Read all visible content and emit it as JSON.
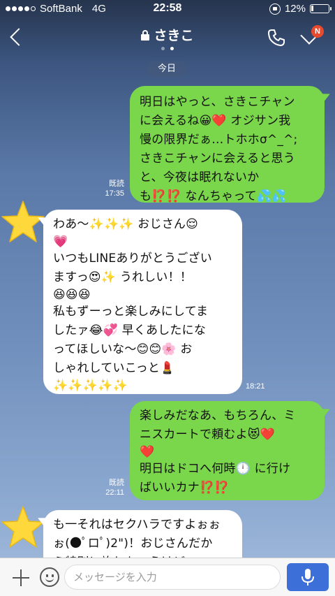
{
  "status_bar": {
    "carrier": "SoftBank",
    "network": "4G",
    "time": "22:58",
    "battery": "12%",
    "battery_level": 0.12,
    "signal_bars_filled": 4,
    "signal_bars_total": 5
  },
  "header": {
    "title": "さきこ",
    "notification_badge": "N",
    "page_count": 2,
    "page_active": 1,
    "icons": [
      "back-chevron-icon",
      "lock-icon",
      "phone-icon",
      "chevron-down-icon"
    ]
  },
  "date_separator": "今日",
  "messages": [
    {
      "side": "sent",
      "lines": [
        "明日はやっと、さきこチャン",
        "に会えるね😀❤️ オジサン我",
        "慢の限界だぁ…トホホσ^_^;",
        "さきこチャンに会えると思う",
        "と、今夜は眠れないか",
        "も⁉️⁉️ なんちゃって💦💦"
      ],
      "read": "既読",
      "time": "17:35"
    },
    {
      "side": "received",
      "lines": [
        "わあ〜✨✨✨ おじさん😌",
        "💗",
        "いつもLINEありがとうござい",
        "ますっ😍✨ うれしい！！",
        "😆😆😆",
        "私もずーっと楽しみにしてま",
        "したァ😂💞 早くあしたにな",
        "ってほしいな〜😊😊🌸 お",
        "しゃれしていこっと💄",
        "✨✨✨✨✨"
      ],
      "time": "18:21"
    },
    {
      "side": "sent",
      "lines": [
        "楽しみだなあ、もちろん、ミ",
        "ニスカートで頼むよ😻❤️",
        "❤️",
        "明日はドコへ何時🕛 に行け",
        "ばいいカナ⁉️⁉️"
      ],
      "read": "既読",
      "time": "22:11"
    },
    {
      "side": "received",
      "lines": [
        "も一それはセクハラですよぉぉ",
        "ぉ(●ﾟロﾟ)2\")！おじさんだか",
        "ら特別に許しちゃうけど"
      ]
    }
  ],
  "composer": {
    "placeholder": "メッセージを入力",
    "icons": [
      "plus-icon",
      "emoji-icon",
      "microphone-icon"
    ]
  },
  "colors": {
    "sent_bubble": "#7ad64b",
    "received_bubble": "#ffffff",
    "mic_button": "#3d6fd8",
    "badge": "#e74a2f"
  }
}
